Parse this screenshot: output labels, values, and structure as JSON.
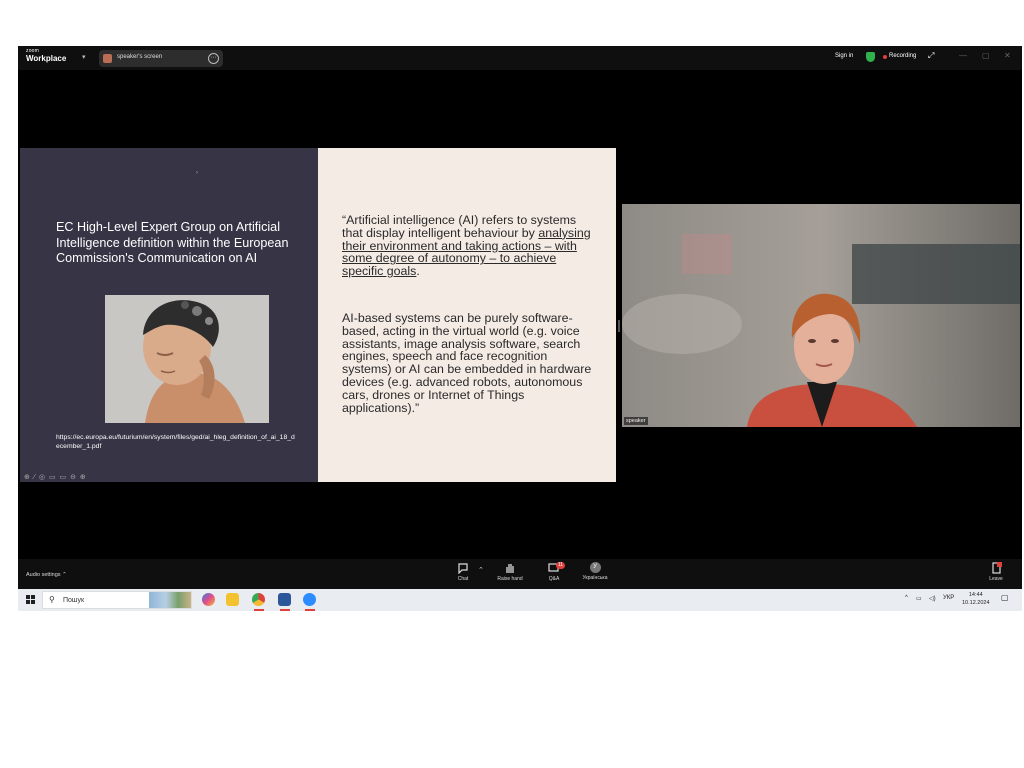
{
  "titlebar": {
    "logo_small": "zoom",
    "logo_big": "Workplace",
    "share_tab_label": "speaker's screen",
    "sign_in": "Sign in",
    "recording": "Recording"
  },
  "slide": {
    "title": "EC High-Level Expert Group on Artificial Intelligence definition within the European Commission's Communication on AI",
    "source_url": "https://ec.europa.eu/futurium/en/system/files/ged/ai_hleg_definition_of_ai_18_december_1.pdf",
    "quote1_a": "“Artificial intelligence (AI) refers to systems that display intelligent behaviour by ",
    "quote1_u": "analysing their environment and taking actions – with some degree of autonomy – to achieve specific goals",
    "quote1_b": ".",
    "quote2": "AI-based systems can be purely software-based, acting in the virtual world (e.g. voice assistants, image analysis software, search engines, speech and face recognition systems) or AI can be embedded in hardware devices (e.g. advanced robots, autonomous cars, drones or Internet of Things applications).”"
  },
  "video": {
    "speaker_label": "speaker"
  },
  "controls": {
    "audio_settings": "Audio settings",
    "chat": "Chat",
    "raise_hand": "Raise hand",
    "qa": "Q&A",
    "qa_badge": "11",
    "language": "Українська",
    "language_initial": "У",
    "leave": "Leave"
  },
  "taskbar": {
    "search_placeholder": "Пошук",
    "lang": "УКР",
    "time": "14:44",
    "date": "10.12.2024"
  },
  "colors": {
    "slide_left_bg": "#363445",
    "slide_right_bg": "#f5ebe5",
    "secure_green": "#2fb24c",
    "record_red": "#e0403a"
  }
}
